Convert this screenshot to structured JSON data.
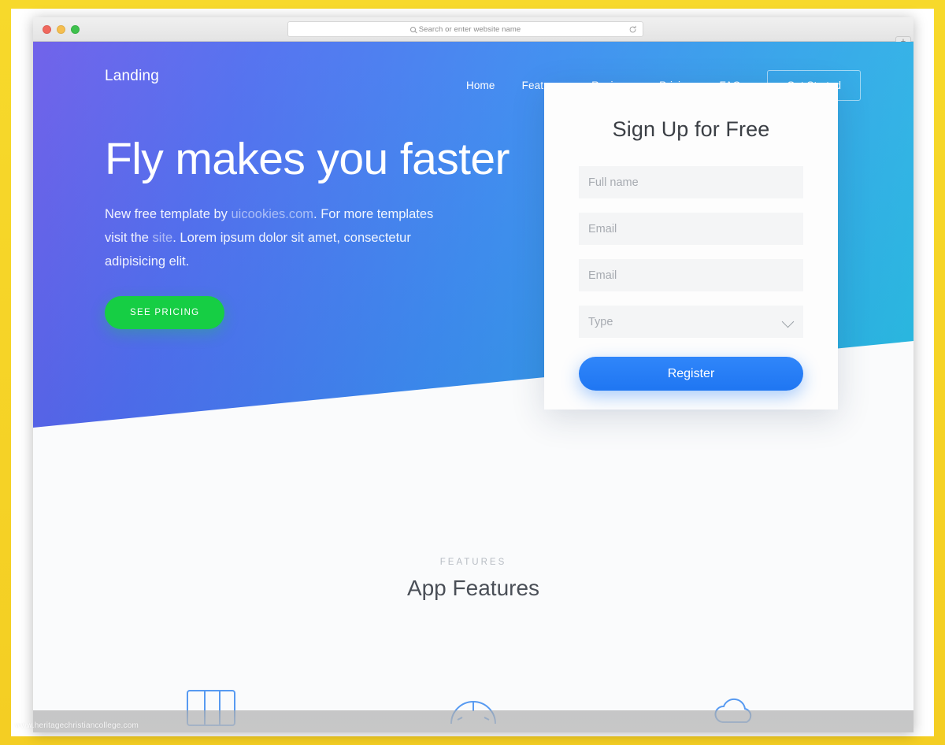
{
  "browser": {
    "traffic_lights": [
      "close",
      "minimize",
      "maximize"
    ],
    "address_placeholder": "Search or enter website name",
    "reload_icon": "reload-icon",
    "search_icon": "search-icon",
    "new_tab_label": "+"
  },
  "site": {
    "brand": "Landing",
    "nav": [
      {
        "label": "Home"
      },
      {
        "label": "Features"
      },
      {
        "label": "Reviews"
      },
      {
        "label": "Pricing"
      },
      {
        "label": "FAQ"
      }
    ],
    "cta_nav": "Get Started"
  },
  "hero": {
    "headline": "Fly makes you faster",
    "paragraph_part1": "New free template by ",
    "paragraph_link1": "uicookies.com",
    "paragraph_part2": ". For more templates visit the ",
    "paragraph_link2": "site",
    "paragraph_part3": ". Lorem ipsum dolor sit amet, consectetur adipisicing elit.",
    "button": "SEE PRICING",
    "gradient_start": "#6A5BE9",
    "gradient_end": "#27BEE3",
    "button_color": "#16CE44"
  },
  "signup": {
    "title": "Sign Up for Free",
    "fields": [
      {
        "placeholder": "Full name",
        "type": "text"
      },
      {
        "placeholder": "Email",
        "type": "email"
      },
      {
        "placeholder": "Email",
        "type": "email"
      },
      {
        "placeholder": "Type",
        "type": "select"
      }
    ],
    "submit": "Register",
    "submit_color": "#2680F8"
  },
  "features": {
    "eyebrow": "FEATURES",
    "title": "App Features",
    "icons": [
      {
        "name": "columns-layout-icon"
      },
      {
        "name": "speedometer-icon"
      },
      {
        "name": "cloud-icon"
      }
    ],
    "accent_color": "#3B8AF0"
  },
  "watermark": "www.heritagechristiancollege.com"
}
